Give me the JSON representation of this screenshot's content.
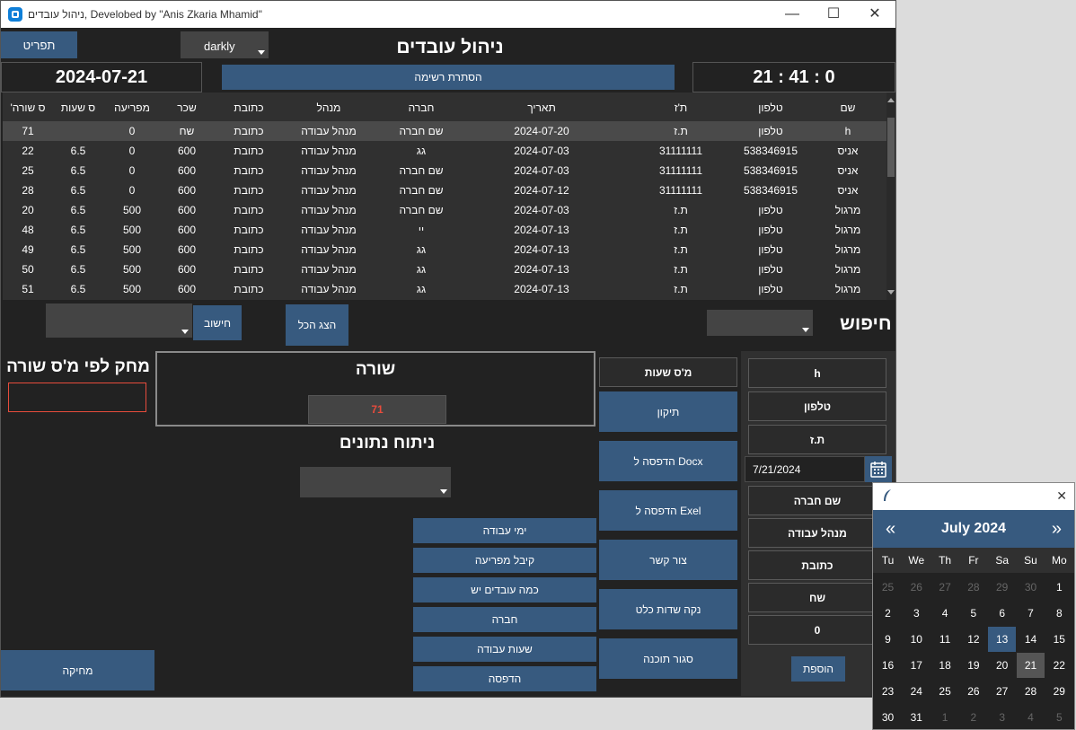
{
  "window": {
    "title": "ניהול עובדים, Develobed by \"Anis Zkaria Mhamid\"",
    "minimize_glyph": "—",
    "maximize_glyph": "☐",
    "close_glyph": "✕"
  },
  "top": {
    "menu_button": "תפריט",
    "theme_select": "darkly",
    "app_heading": "ניהול עובדים",
    "date": "2024-07-21",
    "hide_list_button": "הסתרת רשימה",
    "clock": "21 : 41 : 0"
  },
  "table": {
    "columns": [
      "שם",
      "טלפון",
      "ת'ז",
      "תאריך",
      "חברה",
      "מנהל",
      "כתובת",
      "שכר",
      "מפריעה",
      "ס שעות",
      "'ס שורה"
    ],
    "rows": [
      [
        "h",
        "טלפון",
        "ת.ז",
        "2024-07-20",
        "שם חברה",
        "מנהל עבודה",
        "כתובת",
        "שח",
        "0",
        "",
        "71"
      ],
      [
        "אניס",
        "538346915",
        "31111111",
        "2024-07-03",
        "גג",
        "מנהל עבודה",
        "כתובת",
        "600",
        "0",
        "6.5",
        "22"
      ],
      [
        "אניס",
        "538346915",
        "31111111",
        "2024-07-03",
        "שם חברה",
        "מנהל עבודה",
        "כתובת",
        "600",
        "0",
        "6.5",
        "25"
      ],
      [
        "אניס",
        "538346915",
        "31111111",
        "2024-07-12",
        "שם חברה",
        "מנהל עבודה",
        "כתובת",
        "600",
        "0",
        "6.5",
        "28"
      ],
      [
        "מרגול",
        "טלפון",
        "ת.ז",
        "2024-07-03",
        "שם חברה",
        "מנהל עבודה",
        "כתובת",
        "600",
        "500",
        "6.5",
        "20"
      ],
      [
        "מרגול",
        "טלפון",
        "ת.ז",
        "2024-07-13",
        "יי",
        "מנהל עבודה",
        "כתובת",
        "600",
        "500",
        "6.5",
        "48"
      ],
      [
        "מרגול",
        "טלפון",
        "ת.ז",
        "2024-07-13",
        "גג",
        "מנהל עבודה",
        "כתובת",
        "600",
        "500",
        "6.5",
        "49"
      ],
      [
        "מרגול",
        "טלפון",
        "ת.ז",
        "2024-07-13",
        "גג",
        "מנהל עבודה",
        "כתובת",
        "600",
        "500",
        "6.5",
        "50"
      ],
      [
        "מרגול",
        "טלפון",
        "ת.ז",
        "2024-07-13",
        "גג",
        "מנהל עבודה",
        "כתובת",
        "600",
        "500",
        "6.5",
        "51"
      ]
    ]
  },
  "controls": {
    "calc_button": "חישוב",
    "show_all_button": "הצג הכל",
    "search_label": "חיפוש",
    "delete_by_row_label": "מחק לפי מ'ס שורה",
    "delete_row_input": "",
    "row_box_title": "שורה",
    "row_box_value": "71",
    "data_analysis_label": "ניתוח נתונים",
    "delete_button": "מחיקה",
    "hours_count_button": "מ'ס שעות"
  },
  "analysis_buttons": [
    "ימי עבודה",
    "קיבל מפריעה",
    "כמה עובדים יש",
    "חברה",
    "שעות עבודה",
    "הדפסה"
  ],
  "action_buttons": [
    "תיקון",
    "הדפסה ל Docx",
    "הדפסה ל Exel",
    "צור קשר",
    "נקה שדות כלט",
    "סגור תוכנה"
  ],
  "form": {
    "name": "h",
    "phone": "טלפון",
    "id": "ת.ז",
    "date": "7/21/2024",
    "company": "שם חברה",
    "manager": "מנהל עבודה",
    "address": "כתובת",
    "salary": "שח",
    "advance": "0",
    "add_button": "הוספת"
  },
  "calendar": {
    "month_label": "July 2024",
    "prev": "«",
    "next": "»",
    "close_glyph": "✕",
    "days_of_week": [
      "Tu",
      "We",
      "Th",
      "Fr",
      "Sa",
      "Su",
      "Mo"
    ],
    "weeks": [
      [
        "25",
        "26",
        "27",
        "28",
        "29",
        "30",
        "1"
      ],
      [
        "2",
        "3",
        "4",
        "5",
        "6",
        "7",
        "8"
      ],
      [
        "9",
        "10",
        "11",
        "12",
        "13",
        "14",
        "15"
      ],
      [
        "16",
        "17",
        "18",
        "19",
        "20",
        "21",
        "22"
      ],
      [
        "23",
        "24",
        "25",
        "26",
        "27",
        "28",
        "29"
      ],
      [
        "30",
        "31",
        "1",
        "2",
        "3",
        "4",
        "5"
      ]
    ],
    "colors": {
      "header": "#375a7f",
      "highlight": "#375a7f",
      "selected": "#555555",
      "weekend_accent": "#e05050"
    }
  },
  "colors": {
    "primary": "#375a7f",
    "background": "#222222",
    "danger": "#e74c3c"
  }
}
